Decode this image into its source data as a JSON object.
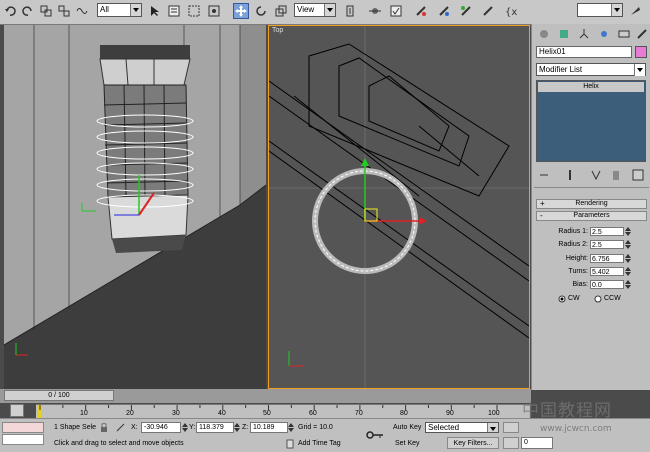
{
  "toolbar": {
    "selection_filter": "All",
    "ref_coord": "View",
    "right_dropdown": "",
    "icons": [
      "undo-icon",
      "redo-icon",
      "select-link-icon",
      "unlink-icon",
      "bind-spacewarp-icon",
      "select-object-icon",
      "select-by-name-icon",
      "rect-selection-icon",
      "window-crossing-icon",
      "select-move-icon",
      "select-rotate-icon",
      "select-scale-icon",
      "pivot-icon",
      "mirror-icon",
      "snap-icon",
      "angle-snap-icon",
      "percent-snap-icon",
      "spinner-snap-icon",
      "named-selection-icon",
      "material-editor-icon",
      "render-scene-icon",
      "quick-render-icon"
    ]
  },
  "viewports": {
    "top_label": "Top",
    "perspective_label": ""
  },
  "command_panel": {
    "object_name": "Helix01",
    "object_color": "#e87bd6",
    "modifier_list": "Modifier List",
    "stack_items": [
      "Helix"
    ],
    "rollouts": {
      "rendering": "Rendering",
      "parameters": "Parameters"
    },
    "params": [
      {
        "label": "Radius 1:",
        "value": "2.5"
      },
      {
        "label": "Radius 2:",
        "value": "2.5"
      },
      {
        "label": "Height:",
        "value": "6.756"
      },
      {
        "label": "Turns:",
        "value": "5.402"
      },
      {
        "label": "Bias:",
        "value": "0.0"
      }
    ],
    "direction": {
      "cw": "CW",
      "ccw": "CCW",
      "selected": "CW"
    }
  },
  "timeline": {
    "slider_text": "0 / 100",
    "ticks": [
      "10",
      "20",
      "30",
      "40",
      "50",
      "60",
      "70",
      "80",
      "90",
      "100"
    ]
  },
  "status": {
    "selection": "1 Shape Sele",
    "x_label": "X:",
    "x_value": "-30.946",
    "y_label": "Y:",
    "y_value": "118.379",
    "z_label": "Z:",
    "z_value": "10.189",
    "grid": "Grid = 10.0",
    "prompt": "Click and drag to select and move objects",
    "add_time_tag": "Add Time Tag",
    "auto_key": "Auto Key",
    "auto_key_value": "Selected",
    "set_key": "Set Key",
    "key_filters": "Key Filters...",
    "frame_value": "0"
  },
  "watermark": {
    "line1": "中国教程网",
    "line2": "www.jcwcn.com"
  }
}
